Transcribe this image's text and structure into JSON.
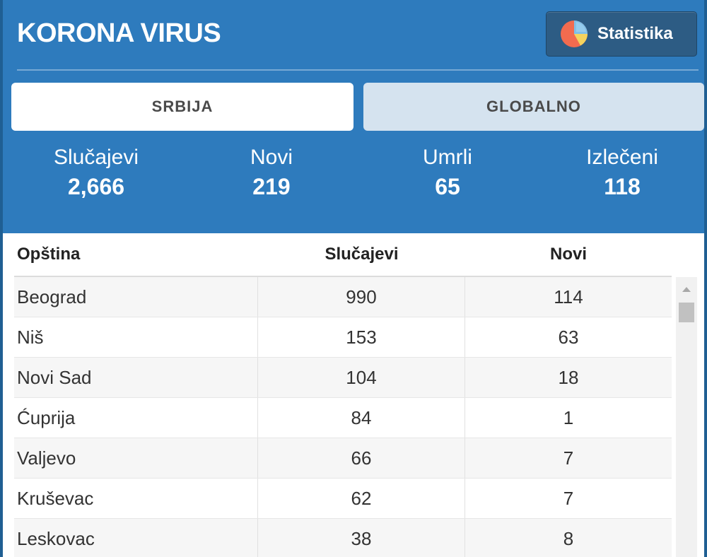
{
  "header": {
    "title": "KORONA VIRUS",
    "stats_button_label": "Statistika"
  },
  "tabs": [
    {
      "label": "SRBIJA",
      "active": true
    },
    {
      "label": "GLOBALNO",
      "active": false
    }
  ],
  "summary": [
    {
      "label": "Slučajevi",
      "value": "2,666"
    },
    {
      "label": "Novi",
      "value": "219"
    },
    {
      "label": "Umrli",
      "value": "65"
    },
    {
      "label": "Izlečeni",
      "value": "118"
    }
  ],
  "table": {
    "headers": [
      "Opština",
      "Slučajevi",
      "Novi"
    ],
    "rows": [
      [
        "Beograd",
        "990",
        "114"
      ],
      [
        "Niš",
        "153",
        "63"
      ],
      [
        "Novi Sad",
        "104",
        "18"
      ],
      [
        "Ćuprija",
        "84",
        "1"
      ],
      [
        "Valjevo",
        "66",
        "7"
      ],
      [
        "Kruševac",
        "62",
        "7"
      ],
      [
        "Leskovac",
        "38",
        "8"
      ]
    ]
  },
  "colors": {
    "header_bg": "#2e7bbd",
    "button_bg": "#2d5c84",
    "inactive_tab_bg": "#d5e3ef"
  },
  "icons": {
    "stats_button": "pie-chart-icon",
    "scroll_up": "caret-up-icon"
  }
}
